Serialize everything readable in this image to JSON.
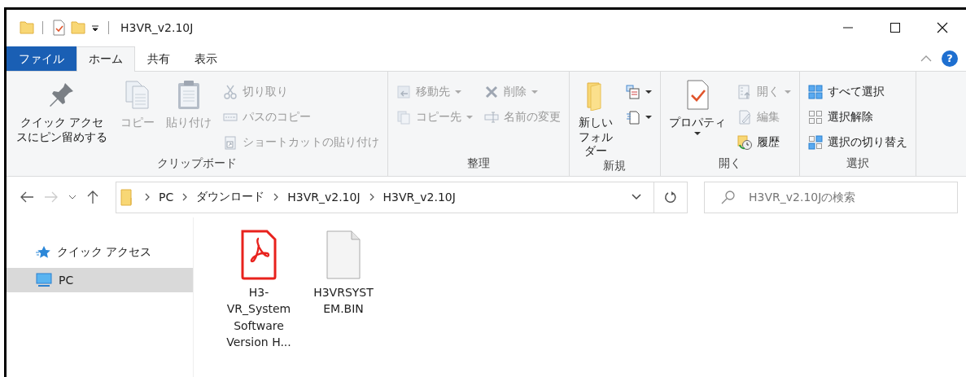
{
  "window": {
    "title": "H3VR_v2.10J"
  },
  "tabs": [
    {
      "label": "ファイル",
      "kind": "file",
      "selected": false
    },
    {
      "label": "ホーム",
      "kind": "tab",
      "selected": true
    },
    {
      "label": "共有",
      "kind": "tab",
      "selected": false
    },
    {
      "label": "表示",
      "kind": "tab",
      "selected": false
    }
  ],
  "help": "?",
  "ribbon": {
    "groups": [
      {
        "label": "クリップボード",
        "columns": [
          {
            "kind": "large",
            "items": [
              {
                "label": "クイック アクセスにピン留めする",
                "disabled": false,
                "dropdown": false
              }
            ]
          },
          {
            "kind": "large",
            "items": [
              {
                "label": "コピー",
                "disabled": true,
                "dropdown": false
              }
            ]
          },
          {
            "kind": "large",
            "items": [
              {
                "label": "貼り付け",
                "disabled": true,
                "dropdown": false
              }
            ]
          },
          {
            "kind": "small",
            "items": [
              {
                "label": "切り取り",
                "disabled": true,
                "dropdown": false
              },
              {
                "label": "パスのコピー",
                "disabled": true,
                "dropdown": false
              },
              {
                "label": "ショートカットの貼り付け",
                "disabled": true,
                "dropdown": false
              }
            ]
          }
        ]
      },
      {
        "label": "整理",
        "columns": [
          {
            "kind": "small",
            "items": [
              {
                "label": "移動先",
                "disabled": true,
                "dropdown": true
              },
              {
                "label": "コピー先",
                "disabled": true,
                "dropdown": true
              }
            ]
          },
          {
            "kind": "small",
            "items": [
              {
                "label": "削除",
                "disabled": true,
                "dropdown": true
              },
              {
                "label": "名前の変更",
                "disabled": true,
                "dropdown": false
              }
            ]
          }
        ]
      },
      {
        "label": "新規",
        "columns": [
          {
            "kind": "large",
            "items": [
              {
                "label": "新しいフォルダー",
                "disabled": false,
                "dropdown": false
              }
            ]
          },
          {
            "kind": "small",
            "items": [
              {
                "disabled": false,
                "dropdown": true
              },
              {
                "disabled": false,
                "dropdown": true
              }
            ]
          }
        ]
      },
      {
        "label": "開く",
        "columns": [
          {
            "kind": "large",
            "items": [
              {
                "label": "プロパティ",
                "disabled": false,
                "dropdown": true
              }
            ]
          },
          {
            "kind": "small",
            "items": [
              {
                "label": "開く",
                "disabled": true,
                "dropdown": true
              },
              {
                "label": "編集",
                "disabled": true,
                "dropdown": false
              },
              {
                "label": "履歴",
                "disabled": false,
                "dropdown": false
              }
            ]
          }
        ]
      },
      {
        "label": "選択",
        "columns": [
          {
            "kind": "small",
            "items": [
              {
                "label": "すべて選択",
                "disabled": false,
                "dropdown": false
              },
              {
                "label": "選択解除",
                "disabled": false,
                "dropdown": false
              },
              {
                "label": "選択の切り替え",
                "disabled": false,
                "dropdown": false
              }
            ]
          }
        ]
      }
    ]
  },
  "navigation": {
    "back_disabled": false,
    "forward_disabled": true
  },
  "address": {
    "crumbs": [
      "PC",
      "ダウンロード",
      "H3VR_v2.10J",
      "H3VR_v2.10J"
    ]
  },
  "search": {
    "placeholder": "H3VR_v2.10Jの検索"
  },
  "sidebar": {
    "items": [
      {
        "label": "クイック アクセス",
        "kind": "quick",
        "selected": false
      },
      {
        "label": "PC",
        "kind": "pc",
        "selected": true
      }
    ]
  },
  "files": [
    {
      "name": "H3-VR_System Software Version H...",
      "kind": "pdf"
    },
    {
      "name": "H3VRSYSTEM.BIN",
      "kind": "file"
    }
  ]
}
